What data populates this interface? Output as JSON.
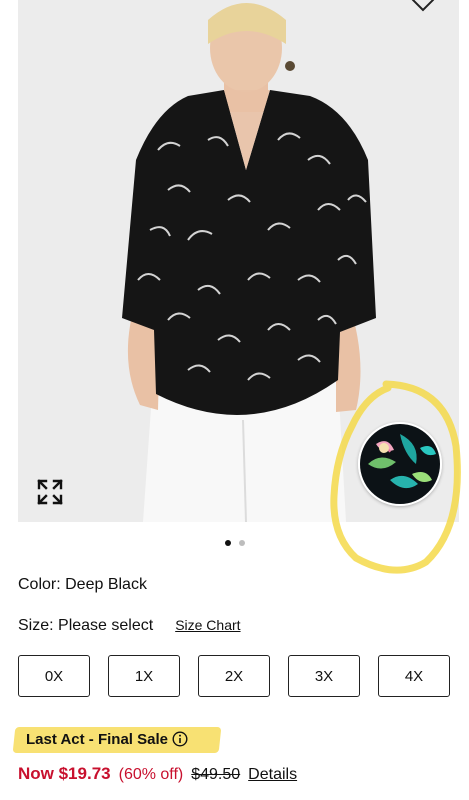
{
  "product": {
    "image_alt": "Woman wearing black printed V-neck blouse with white pants",
    "favorite_icon": "heart-icon",
    "expand_icon": "expand-icon",
    "swatch_pattern": "tropical print",
    "carousel": {
      "total": 2,
      "active": 1
    }
  },
  "color": {
    "label": "Color: Deep Black"
  },
  "size": {
    "label": "Size: Please select",
    "chart_link": "Size Chart",
    "options": [
      "0X",
      "1X",
      "2X",
      "3X",
      "4X"
    ]
  },
  "badge": {
    "text": "Last Act - Final Sale",
    "info_icon": "info-icon"
  },
  "price": {
    "now": "Now $19.73",
    "discount": "(60% off)",
    "original": "$49.50",
    "details_link": "Details"
  },
  "colors": {
    "sale_red": "#c8102e",
    "highlight_yellow": "#f7dc5a",
    "background": "#ededed"
  }
}
